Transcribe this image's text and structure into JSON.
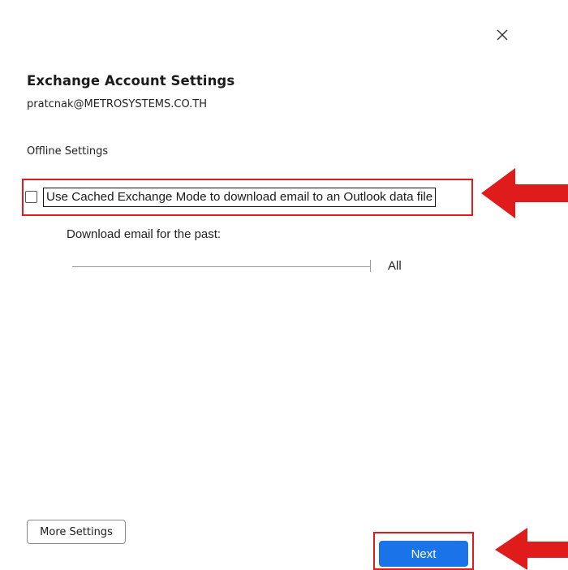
{
  "dialog": {
    "close_icon": "close-icon",
    "title": "Exchange Account Settings",
    "account_email": "pratcnak@METROSYSTEMS.CO.TH",
    "section_title": "Offline Settings"
  },
  "offline": {
    "cached_mode_label": "Use Cached Exchange Mode to download email to an Outlook data file",
    "cached_mode_checked": false,
    "download_label": "Download email for the past:",
    "download_period": "All"
  },
  "footer": {
    "more_settings_label": "More Settings",
    "next_label": "Next"
  },
  "colors": {
    "highlight": "#e01b1b",
    "primary": "#1a73e8",
    "arrow": "#e01b1b"
  }
}
